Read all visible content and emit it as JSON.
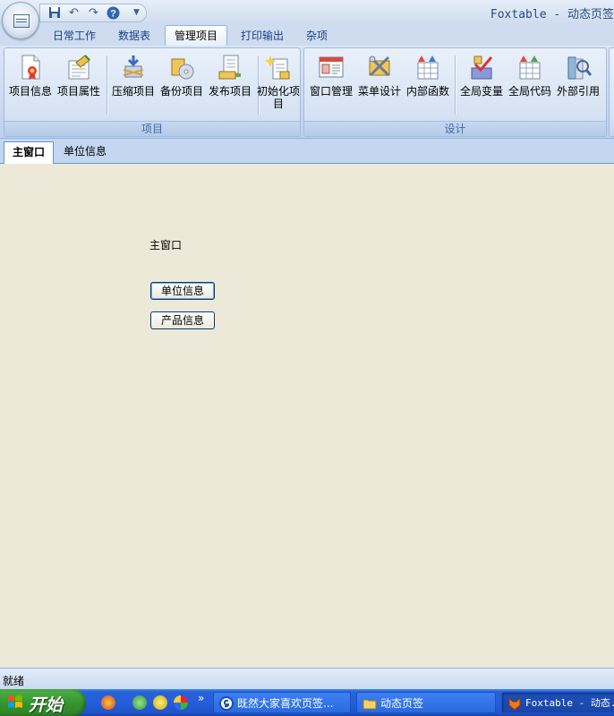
{
  "window": {
    "title": "Foxtable - 动态页签"
  },
  "ribbon": {
    "tabs": [
      {
        "label": "日常工作"
      },
      {
        "label": "数据表"
      },
      {
        "label": "管理项目"
      },
      {
        "label": "打印输出"
      },
      {
        "label": "杂项"
      }
    ],
    "active_tab": "管理项目",
    "groups": [
      {
        "label": "项目",
        "buttons": [
          {
            "label": "项目信息",
            "icon": "certificate-icon"
          },
          {
            "label": "项目属性",
            "icon": "properties-icon"
          },
          {
            "label": "压缩项目",
            "icon": "compress-icon"
          },
          {
            "label": "备份项目",
            "icon": "backup-disk-icon"
          },
          {
            "label": "发布项目",
            "icon": "publish-icon"
          },
          {
            "label": "初始化项目",
            "icon": "initialize-icon"
          }
        ]
      },
      {
        "label": "设计",
        "buttons": [
          {
            "label": "窗口管理",
            "icon": "window-form-icon"
          },
          {
            "label": "菜单设计",
            "icon": "menu-tools-icon"
          },
          {
            "label": "内部函数",
            "icon": "function-icon"
          },
          {
            "label": "全局变量",
            "icon": "variable-icon"
          },
          {
            "label": "全局代码",
            "icon": "global-code-icon"
          },
          {
            "label": "外部引用",
            "icon": "reference-book-icon"
          }
        ]
      }
    ]
  },
  "doc_tabs": [
    {
      "label": "主窗口"
    },
    {
      "label": "单位信息"
    }
  ],
  "main": {
    "label": "主窗口",
    "buttons": [
      {
        "label": "单位信息"
      },
      {
        "label": "产品信息"
      }
    ]
  },
  "status": {
    "text": "就绪"
  },
  "taskbar": {
    "start_label": "开始",
    "overflow": "»",
    "items": [
      {
        "label": "既然大家喜欢页签...",
        "icon": "browser-icon"
      },
      {
        "label": "动态页签",
        "icon": "folder-icon"
      },
      {
        "label": "Foxtable - 动态...",
        "icon": "foxtable-icon"
      }
    ]
  }
}
